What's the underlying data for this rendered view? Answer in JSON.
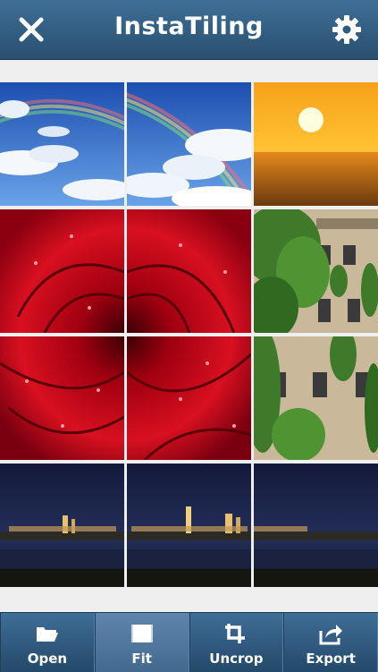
{
  "header": {
    "title": "InstaTiling"
  },
  "icons": {
    "close": "close-icon",
    "settings": "gear-icon"
  },
  "grid": {
    "rows": 4,
    "cols": 3,
    "images": [
      "sky-rainbow",
      "sunset-sea",
      "red-rose",
      "ivy-building",
      "city-night-skyline"
    ]
  },
  "toolbar": {
    "items": [
      {
        "label": "Open",
        "icon": "folder-open-icon"
      },
      {
        "label": "Fit",
        "icon": "fit-icon"
      },
      {
        "label": "Uncrop",
        "icon": "uncrop-icon"
      },
      {
        "label": "Export",
        "icon": "export-icon"
      }
    ],
    "active": "Fit"
  },
  "colors": {
    "bar_top": "#3f6e97",
    "bar_bottom": "#28506f",
    "background": "#efefef"
  }
}
